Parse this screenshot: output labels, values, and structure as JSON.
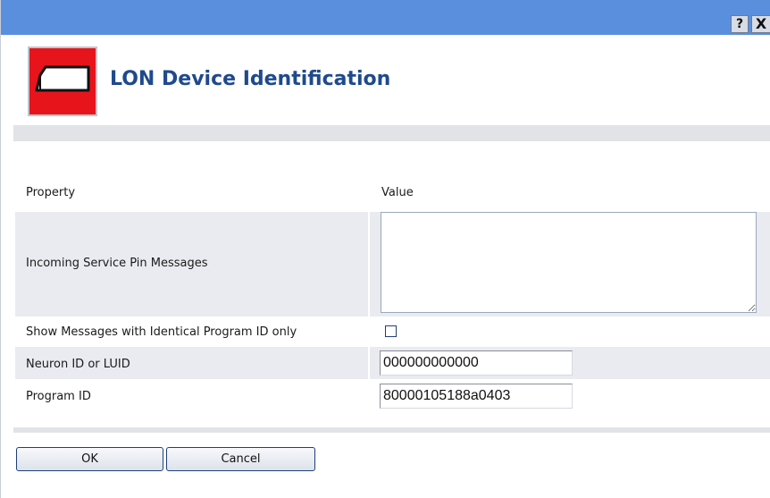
{
  "titlebar": {
    "help_label": "?",
    "close_label": "X",
    "color": "#5a8fde"
  },
  "header": {
    "title": "LON Device Identification",
    "logo_icon": "lon-device-icon",
    "title_color": "#1f4a8c"
  },
  "table": {
    "headers": {
      "property": "Property",
      "value": "Value"
    },
    "rows": [
      {
        "label": "Incoming Service Pin Messages",
        "type": "textarea",
        "value": ""
      },
      {
        "label": "Show Messages with Identical Program ID only",
        "type": "checkbox",
        "checked": false
      },
      {
        "label": "Neuron ID or LUID",
        "type": "text",
        "value": "000000000000"
      },
      {
        "label": "Program ID",
        "type": "text",
        "value": "80000105188a0403"
      }
    ]
  },
  "buttons": {
    "ok_label": "OK",
    "cancel_label": "Cancel"
  }
}
